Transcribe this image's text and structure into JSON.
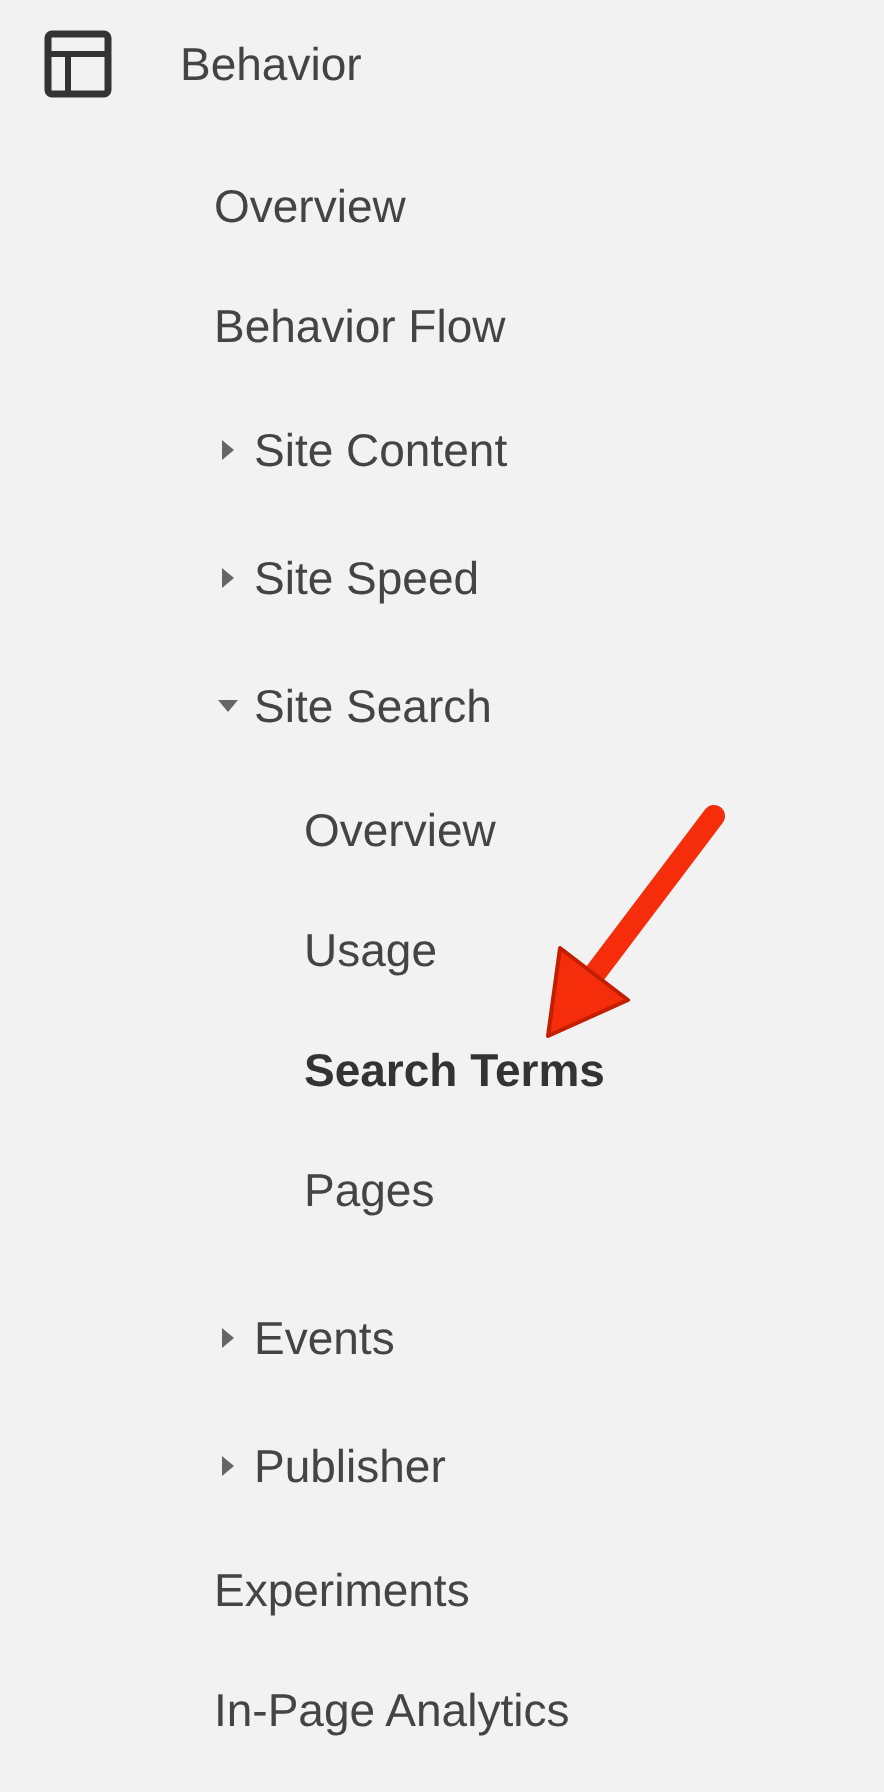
{
  "section": {
    "title": "Behavior"
  },
  "items": [
    {
      "kind": "link",
      "label": "Overview",
      "selected": false
    },
    {
      "kind": "link",
      "label": "Behavior Flow",
      "selected": false
    },
    {
      "kind": "folder",
      "label": "Site Content",
      "expanded": false
    },
    {
      "kind": "folder",
      "label": "Site Speed",
      "expanded": false
    },
    {
      "kind": "folder",
      "label": "Site Search",
      "expanded": true,
      "children": [
        {
          "kind": "link",
          "label": "Overview",
          "selected": false
        },
        {
          "kind": "link",
          "label": "Usage",
          "selected": false
        },
        {
          "kind": "link",
          "label": "Search Terms",
          "selected": true
        },
        {
          "kind": "link",
          "label": "Pages",
          "selected": false
        }
      ]
    },
    {
      "kind": "folder",
      "label": "Events",
      "expanded": false
    },
    {
      "kind": "folder",
      "label": "Publisher",
      "expanded": false
    },
    {
      "kind": "link",
      "label": "Experiments",
      "selected": false
    },
    {
      "kind": "link",
      "label": "In-Page Analytics",
      "selected": false
    }
  ]
}
